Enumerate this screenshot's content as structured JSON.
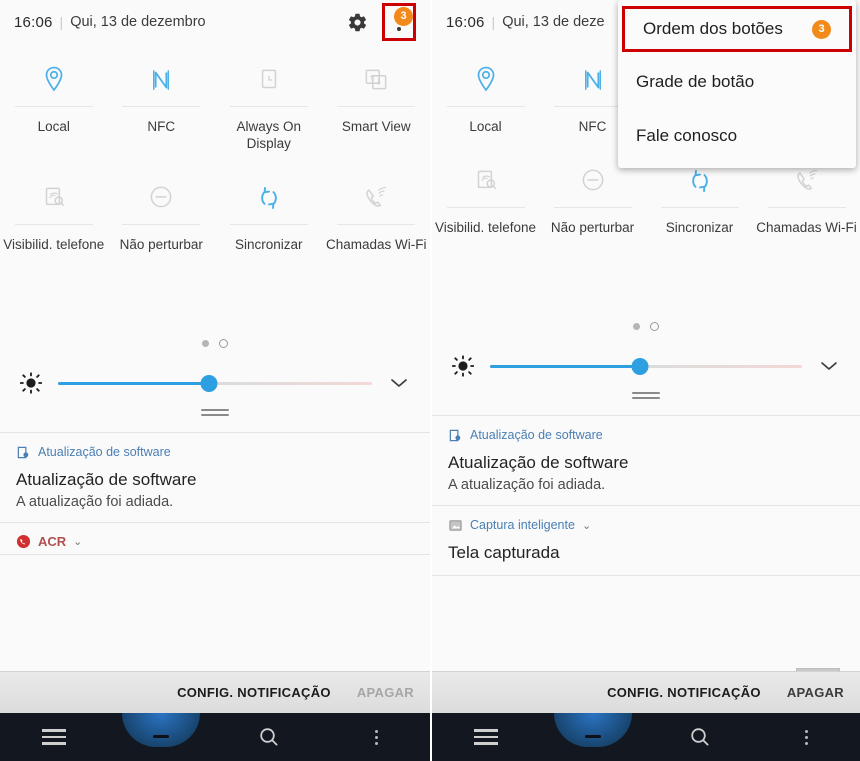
{
  "meta": {
    "screens": [
      "left",
      "right"
    ]
  },
  "statusbar": {
    "time": "16:06",
    "separator": "|",
    "date_left": "Qui, 13 de dezembro",
    "date_right": "Qui, 13 de deze",
    "settings_icon": "gear-icon",
    "overflow_icon": "kebab-menu-icon",
    "overflow_badge": "3",
    "badge_color": "#f28a1b",
    "highlight_color": "#cc0000"
  },
  "quick_settings": {
    "rows": [
      [
        {
          "label": "Local",
          "icon": "location-pin-icon",
          "active": true
        },
        {
          "label": "NFC",
          "icon": "nfc-icon",
          "active": true
        },
        {
          "label": "Always On Display",
          "icon": "always-on-display-icon",
          "active": false
        },
        {
          "label": "Smart View",
          "icon": "smart-view-icon",
          "active": false
        }
      ],
      [
        {
          "label": "Visibilid. telefone",
          "icon": "phone-visibility-icon",
          "active": false
        },
        {
          "label": "Não perturbar",
          "icon": "do-not-disturb-icon",
          "active": false
        },
        {
          "label": "Sincronizar",
          "icon": "sync-icon",
          "active": true
        },
        {
          "label": "Chamadas Wi-Fi",
          "icon": "wifi-calling-icon",
          "active": false
        }
      ]
    ],
    "active_color": "#4ab0e8",
    "inactive_color": "#cfcfcf"
  },
  "pagination": {
    "pages": 2,
    "current": 1,
    "dot_styles": [
      "filled",
      "ring"
    ]
  },
  "brightness": {
    "icon": "brightness-icon",
    "value_percent": 48,
    "expand_icon": "chevron-down-icon",
    "fill_color": "#2e9fe0"
  },
  "notifications": {
    "left": [
      {
        "app": "Atualização de software",
        "app_icon": "software-update-icon",
        "title": "Atualização de software",
        "body": "A atualização foi adiada.",
        "compact": false
      },
      {
        "app": "ACR",
        "app_icon": "call-recorder-icon",
        "title": "",
        "body": "",
        "compact": true,
        "chevron": "⌄"
      }
    ],
    "right": [
      {
        "app": "Atualização de software",
        "app_icon": "software-update-icon",
        "title": "Atualização de software",
        "body": "A atualização foi adiada.",
        "compact": false
      },
      {
        "app": "Captura inteligente",
        "app_icon": "smart-capture-icon",
        "title": "Tela capturada",
        "body": "",
        "compact": false,
        "chevron": "⌄"
      }
    ]
  },
  "action_bar": {
    "settings_label": "CONFIG. NOTIFICAÇÃO",
    "clear_label": "APAGAR"
  },
  "navbar": {
    "recents_icon": "recents-menu-icon",
    "home_icon": "home-button-icon",
    "search_icon": "search-icon",
    "more_icon": "more-vertical-icon"
  },
  "dropdown": {
    "items": [
      {
        "label": "Ordem dos botões",
        "badge": "3",
        "highlighted": true
      },
      {
        "label": "Grade de botão",
        "badge": "",
        "highlighted": false
      },
      {
        "label": "Fale conosco",
        "badge": "",
        "highlighted": false
      }
    ]
  }
}
